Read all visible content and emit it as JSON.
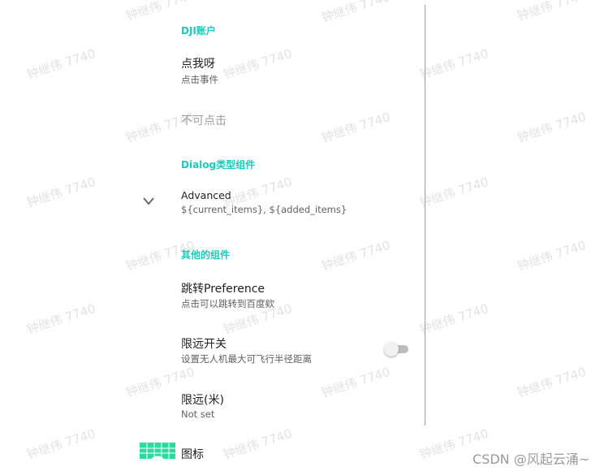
{
  "watermark_text": "钟继伟 7740",
  "colors": {
    "category_accent": "#1fc8b8",
    "icon_green": "#2ed9a0",
    "switch_track_off": "#bdbdbd",
    "switch_thumb_off": "#f1f1f1"
  },
  "categories": {
    "dji_account": "DJI账户",
    "dialog_components": "Dialog类型组件",
    "other_components": "其他的组件"
  },
  "prefs": {
    "click_me": {
      "title": "点我呀",
      "summary": "点击事件"
    },
    "not_clickable": {
      "title": "不可点击"
    },
    "advanced": {
      "title": "Advanced",
      "summary": "${current_items}, ${added_items}",
      "icon": "chevron-down-icon"
    },
    "jump": {
      "title": "跳转Preference",
      "summary": "点击可以跳转到百度欸"
    },
    "limit_switch": {
      "title": "限远开关",
      "summary": "设置无人机最大可飞行半径距离",
      "checked": false
    },
    "limit_distance": {
      "title": "限远(米)",
      "summary": "Not set"
    },
    "icon_pref": {
      "title": "图标",
      "icon": "grid-icon"
    }
  },
  "footer": {
    "credit": "CSDN @风起云涌~"
  }
}
